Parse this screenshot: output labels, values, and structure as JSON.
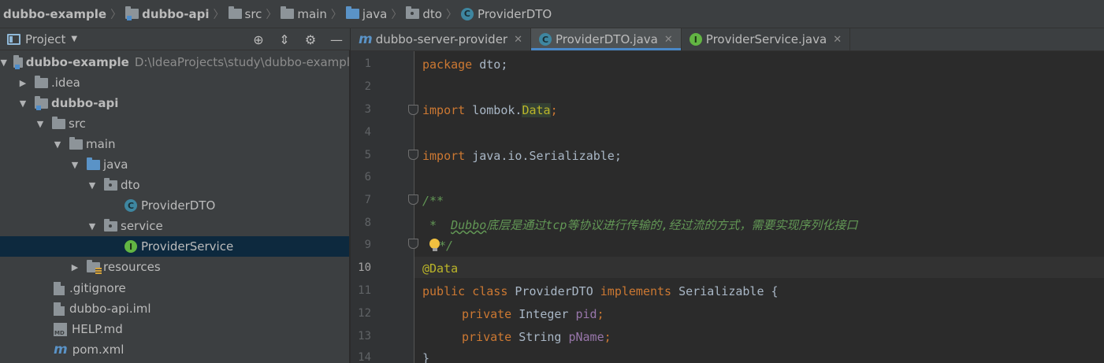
{
  "breadcrumb": {
    "items": [
      {
        "label": "dubbo-example"
      },
      {
        "label": "dubbo-api"
      },
      {
        "label": "src"
      },
      {
        "label": "main"
      },
      {
        "label": "java"
      },
      {
        "label": "dto"
      },
      {
        "label": "ProviderDTO"
      }
    ]
  },
  "project_panel": {
    "title": "Project",
    "tree": [
      {
        "label": "dubbo-example",
        "path": "D:\\IdeaProjects\\study\\dubbo-exampl"
      },
      {
        "label": ".idea"
      },
      {
        "label": "dubbo-api"
      },
      {
        "label": "src"
      },
      {
        "label": "main"
      },
      {
        "label": "java"
      },
      {
        "label": "dto"
      },
      {
        "label": "ProviderDTO",
        "icon_letter": "C"
      },
      {
        "label": "service"
      },
      {
        "label": "ProviderService",
        "icon_letter": "I"
      },
      {
        "label": "resources"
      },
      {
        "label": ".gitignore"
      },
      {
        "label": "dubbo-api.iml"
      },
      {
        "label": "HELP.md"
      },
      {
        "label": "pom.xml"
      }
    ]
  },
  "tabs": [
    {
      "label": "dubbo-server-provider",
      "icon": "m"
    },
    {
      "label": "ProviderDTO.java",
      "icon_letter": "C"
    },
    {
      "label": "ProviderService.java",
      "icon_letter": "I"
    }
  ],
  "editor": {
    "line_numbers": [
      "1",
      "2",
      "3",
      "4",
      "5",
      "6",
      "7",
      "8",
      "9",
      "10",
      "11",
      "12",
      "13",
      "14"
    ],
    "code": {
      "l1_kw": "package",
      "l1_rest": " dto;",
      "l3_kw": "import",
      "l3_mid": " lombok.",
      "l3_hl": "Data",
      "l3_end": ";",
      "l5_kw": "import",
      "l5_rest": " java.io.Serializable;",
      "l7": "/**",
      "l8_star": " *  ",
      "l8_tag": "Dubbo",
      "l8_text": "底层是通过tcp等协议进行传输的,经过流的方式，需要实现序列化接口",
      "l9": " */",
      "l10": "@Data",
      "l11_kw1": "public",
      "l11_kw2": " class",
      "l11_name": " ProviderDTO",
      "l11_kw3": " implements",
      "l11_rest": " Serializable {",
      "l12_kw": "private",
      "l12_type": " Integer ",
      "l12_field": "pid",
      "l12_end": ";",
      "l13_kw": "private",
      "l13_type": " String ",
      "l13_field": "pName",
      "l13_end": ";",
      "l14": "}"
    }
  },
  "colors": {
    "keyword": "#cc7832",
    "annotation": "#bbb529",
    "field": "#9876aa",
    "comment": "#629755",
    "selection": "#0d293e",
    "active_tab_underline": "#4a88c7"
  }
}
